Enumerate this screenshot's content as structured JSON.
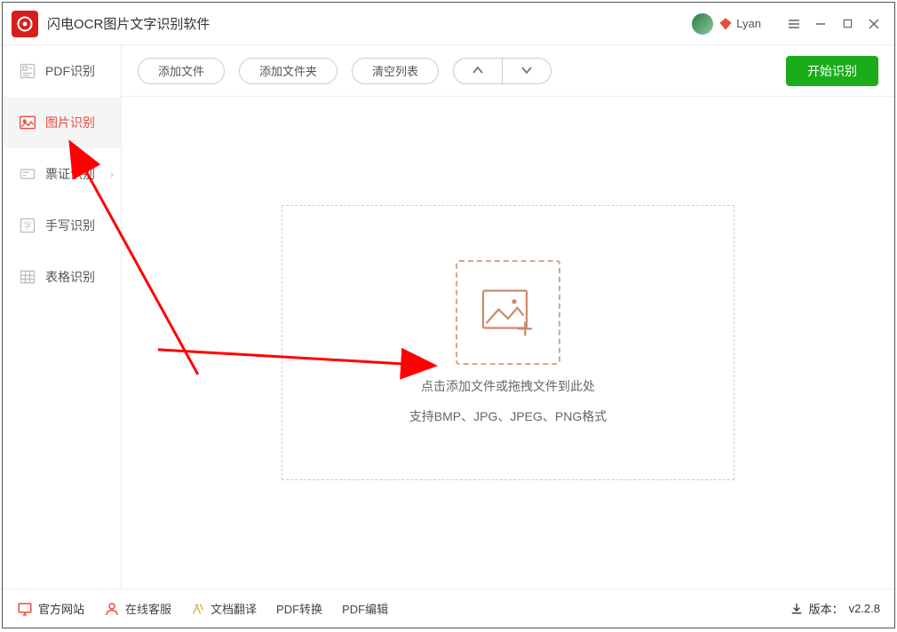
{
  "title": "闪电OCR图片文字识别软件",
  "user": {
    "name": "Lyan"
  },
  "sidebar": {
    "items": [
      {
        "label": "PDF识别"
      },
      {
        "label": "图片识别"
      },
      {
        "label": "票证识别"
      },
      {
        "label": "手写识别"
      },
      {
        "label": "表格识别"
      }
    ]
  },
  "toolbar": {
    "add_file": "添加文件",
    "add_folder": "添加文件夹",
    "clear_list": "清空列表",
    "start": "开始识别"
  },
  "dropzone": {
    "line1": "点击添加文件或拖拽文件到此处",
    "line2": "支持BMP、JPG、JPEG、PNG格式"
  },
  "footer": {
    "site": "官方网站",
    "service": "在线客服",
    "translate": "文档翻译",
    "pdf_convert": "PDF转换",
    "pdf_edit": "PDF编辑",
    "version_label": "版本：",
    "version": "v2.2.8"
  }
}
